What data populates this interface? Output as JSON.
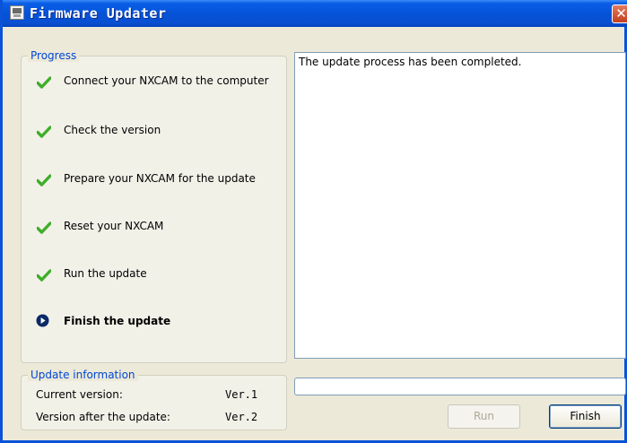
{
  "window": {
    "title": "Firmware Updater"
  },
  "progress": {
    "legend": "Progress",
    "steps": [
      {
        "label": "Connect your NXCAM to the computer",
        "status": "done"
      },
      {
        "label": "Check the version",
        "status": "done"
      },
      {
        "label": "Prepare your NXCAM for the update",
        "status": "done"
      },
      {
        "label": "Reset your NXCAM",
        "status": "done"
      },
      {
        "label": "Run the update",
        "status": "done"
      },
      {
        "label": "Finish the update",
        "status": "current"
      }
    ]
  },
  "info": {
    "legend": "Update information",
    "current_label": "Current version:",
    "current_value": "Ver.1",
    "after_label": "Version after the update:",
    "after_value": "Ver.2"
  },
  "log": {
    "text": "The update process has been completed."
  },
  "progress_bar": {
    "value": 0
  },
  "buttons": {
    "run": "Run",
    "finish": "Finish"
  },
  "colors": {
    "check": "#3fae2a",
    "current_icon": "#0b2a66",
    "legend": "#0046d5"
  },
  "icons": {
    "done": "check-icon",
    "current": "arrow-right-circle-icon",
    "close": "close-icon",
    "app": "app-icon"
  }
}
